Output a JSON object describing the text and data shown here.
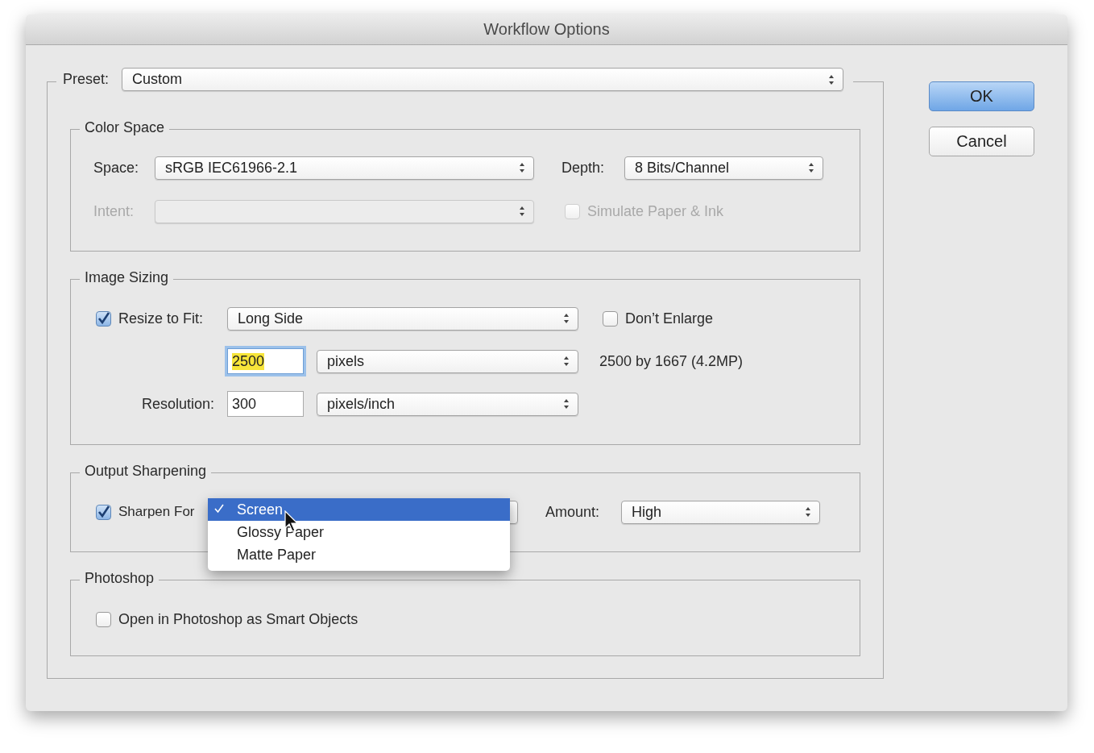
{
  "window": {
    "title": "Workflow Options"
  },
  "preset": {
    "label": "Preset:",
    "value": "Custom"
  },
  "buttons": [
    {
      "label": "OK",
      "default": true
    },
    {
      "label": "Cancel",
      "default": false
    }
  ],
  "color_space": {
    "title": "Color Space",
    "space": {
      "label": "Space:",
      "value": "sRGB IEC61966-2.1"
    },
    "depth": {
      "label": "Depth:",
      "value": "8 Bits/Channel"
    },
    "intent": {
      "label": "Intent:",
      "disabled": true
    },
    "simulate": {
      "label": "Simulate Paper & Ink",
      "checked": false,
      "disabled": true
    }
  },
  "image_sizing": {
    "title": "Image Sizing",
    "resize": {
      "label": "Resize to Fit:",
      "checked": true,
      "value": "Long Side"
    },
    "dont_enlarge": {
      "label": "Don’t Enlarge",
      "checked": false
    },
    "size": {
      "value": "2500",
      "unit": "pixels",
      "focused": true
    },
    "summary": "2500 by 1667 (4.2MP)",
    "resolution": {
      "label": "Resolution:",
      "value": "300",
      "unit": "pixels/inch"
    }
  },
  "output_sharpening": {
    "title": "Output Sharpening",
    "sharpen": {
      "label": "Sharpen For",
      "checked": true
    },
    "menu": [
      {
        "label": "Screen",
        "selected": true
      },
      {
        "label": "Glossy Paper",
        "selected": false
      },
      {
        "label": "Matte Paper",
        "selected": false
      }
    ],
    "amount": {
      "label": "Amount:",
      "value": "High"
    }
  },
  "photoshop": {
    "title": "Photoshop",
    "open_smart": {
      "label": "Open in Photoshop as Smart Objects",
      "checked": false
    }
  }
}
